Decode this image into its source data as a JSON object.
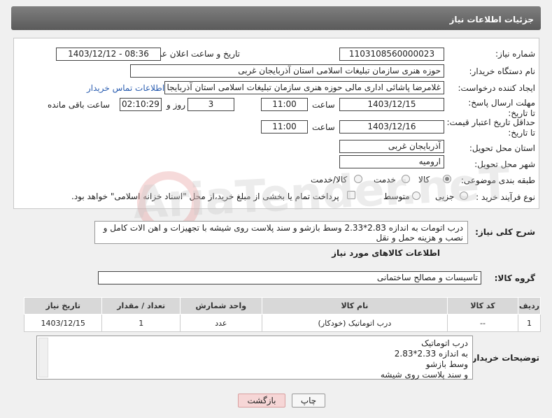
{
  "header": {
    "title": "جزئیات اطلاعات نیاز"
  },
  "form": {
    "need_number_label": "شماره نیاز:",
    "need_number": "1103108560000023",
    "announce_label": "تاریخ و ساعت اعلان عمومی:",
    "announce_value": "1403/12/12 - 08:36",
    "buyer_org_label": "نام دستگاه خریدار:",
    "buyer_org": "حوزه هنری سازمان تبلیغات اسلامی استان آذربایجان غربی",
    "requester_label": "ایجاد کننده درخواست:",
    "requester": "غلامرضا پاشائی اداری مالی حوزه هنری سازمان تبلیغات اسلامی استان آذربایجا",
    "contact_link": "اطلاعات تماس خریدار",
    "deadline_label": "مهلت ارسال پاسخ: تا تاریخ:",
    "deadline_date": "1403/12/15",
    "time_label": "ساعت",
    "deadline_time": "11:00",
    "days_value": "3",
    "days_label": "روز و",
    "remaining_time": "02:10:29",
    "remaining_label": "ساعت باقی مانده",
    "validity_label": "حداقل تاریخ اعتبار قیمت: تا تاریخ:",
    "validity_date": "1403/12/16",
    "validity_time_label": "ساعت",
    "validity_time": "11:00",
    "province_label": "استان محل تحویل:",
    "province": "آذربایجان غربی",
    "city_label": "شهر محل تحویل:",
    "city": "ارومیه",
    "category_label": "طبقه بندی موضوعی:",
    "category_options": [
      "کالا",
      "خدمت",
      "کالا/خدمت"
    ],
    "process_label": "نوع فرآیند خرید :",
    "process_options": [
      "جزیی",
      "متوسط"
    ],
    "payment_text": "پرداخت تمام یا بخشی از مبلغ خرید،از محل \"اسناد خزانه اسلامی\" خواهد بود."
  },
  "description": {
    "label": "شرح کلی نیاز:",
    "text": "درب اتومات به اندازه 2.83*2.33 وسط بازشو و سند پلاست روی شیشه با تجهیزات و اهن الات کامل و نصب و هزینه حمل و نقل"
  },
  "goods_section": {
    "title": "اطلاعات کالاهای مورد نیاز",
    "group_label": "گروه کالا:",
    "group_value": "تاسیسات و مصالح ساختمانی"
  },
  "table": {
    "headers": [
      "ردیف",
      "کد کالا",
      "نام کالا",
      "واحد شمارش",
      "تعداد / مقدار",
      "تاریخ نیاز"
    ],
    "rows": [
      [
        "1",
        "--",
        "درب اتوماتیک (خودکار)",
        "عدد",
        "1",
        "1403/12/15"
      ]
    ]
  },
  "notes": {
    "label": "توضیحات خریدار:",
    "lines": [
      "درب اتوماتیک",
      "به اندازه 2.33*2.83",
      "وسط بازشو",
      "و سند پلاست روی شیشه"
    ]
  },
  "buttons": {
    "print": "چاپ",
    "back": "بازگشت"
  },
  "watermark": "AriaTender.neT"
}
